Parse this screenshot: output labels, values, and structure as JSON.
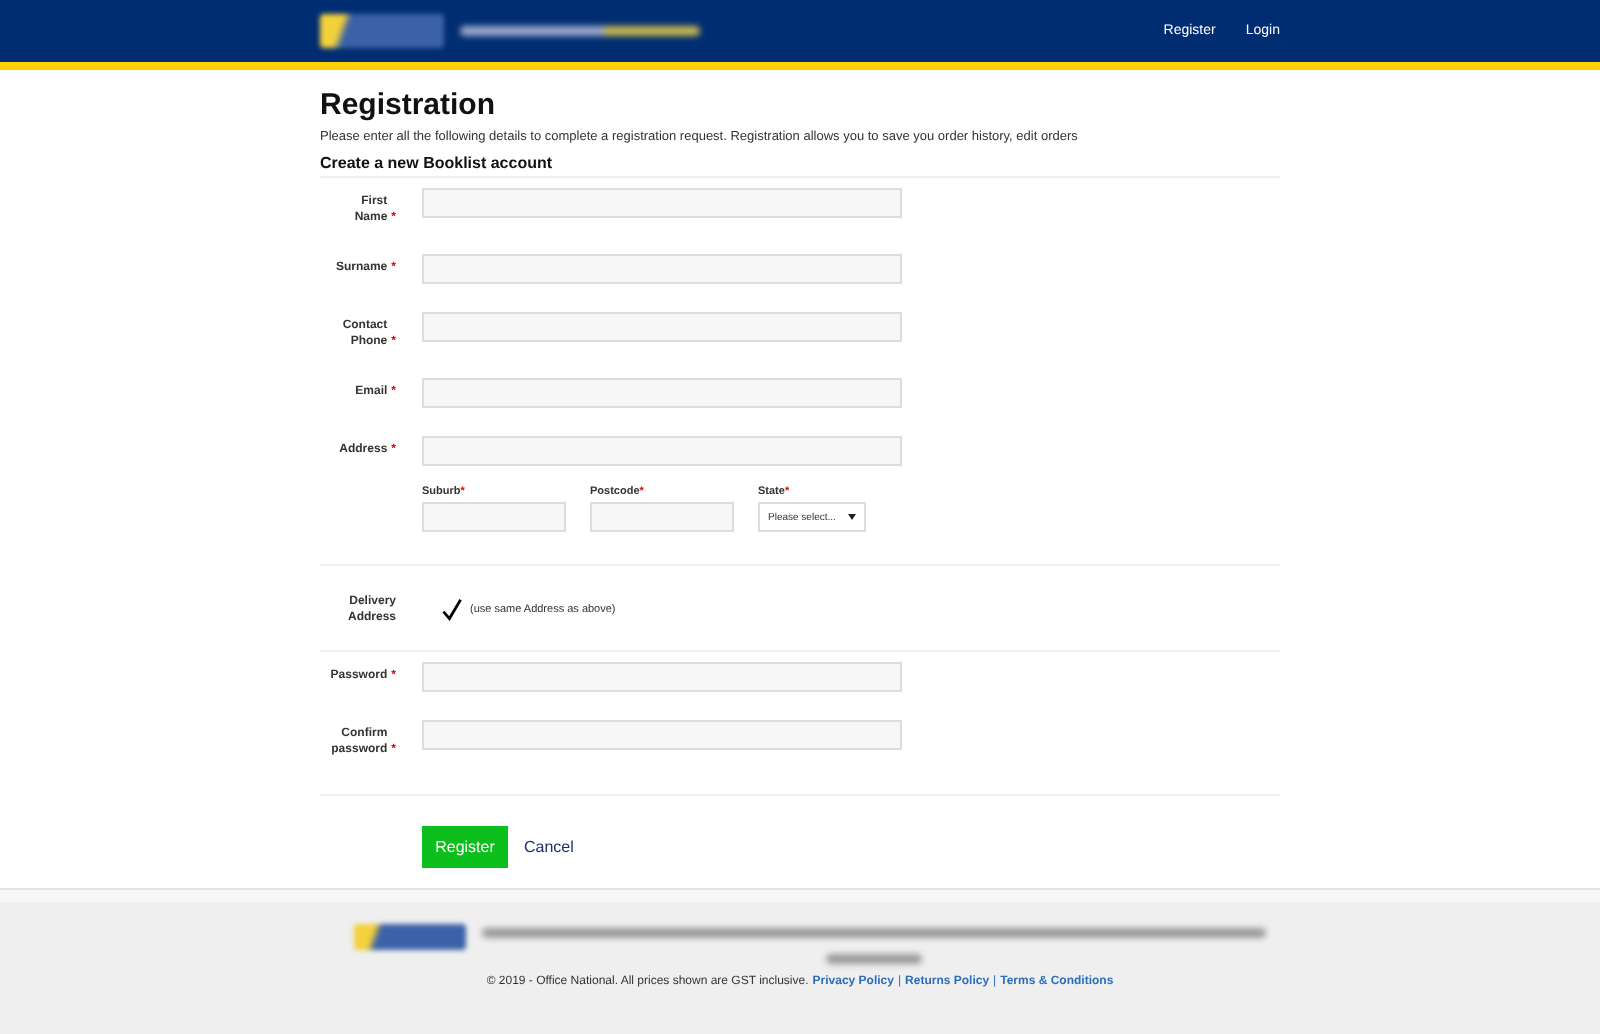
{
  "header": {
    "nav": [
      "Register",
      "Login"
    ]
  },
  "page": {
    "title": "Registration",
    "intro": "Please enter all the following details to complete a registration request. Registration allows you to save you order history, edit orders",
    "subtitle": "Create a new Booklist account"
  },
  "form": {
    "groups": [
      {
        "fields": [
          {
            "label": "First Name",
            "required_mark": "*"
          },
          {
            "label": "Surname",
            "required_mark": "*"
          },
          {
            "label": "Contact Phone",
            "required_mark": "*"
          },
          {
            "label": "Email",
            "required_mark": "*"
          },
          {
            "label": "Address",
            "required_mark": "*"
          }
        ],
        "sub_fields": [
          {
            "label": "Suburb",
            "required_mark": "*",
            "kind": "text"
          },
          {
            "label": "Postcode",
            "required_mark": "*",
            "kind": "text"
          },
          {
            "label": "State",
            "required_mark": "*",
            "kind": "select",
            "value": "Please select..."
          }
        ]
      },
      {
        "checkbox": {
          "label": "Delivery Address",
          "text": "(use same Address as above)",
          "checked": true
        }
      },
      {
        "fields": [
          {
            "label": "Password",
            "required_mark": "*"
          },
          {
            "label": "Confirm password",
            "required_mark": "*"
          }
        ]
      }
    ],
    "buttons": [
      {
        "label": "Register",
        "kind": "primary"
      },
      {
        "label": "Cancel",
        "kind": "link"
      }
    ]
  },
  "footer": {
    "copyright": "© 2019 - Office National. All prices shown are GST inclusive.",
    "links": [
      "Privacy Policy",
      "Returns Policy",
      "Terms & Conditions"
    ],
    "separators": [
      "|",
      "|"
    ]
  }
}
